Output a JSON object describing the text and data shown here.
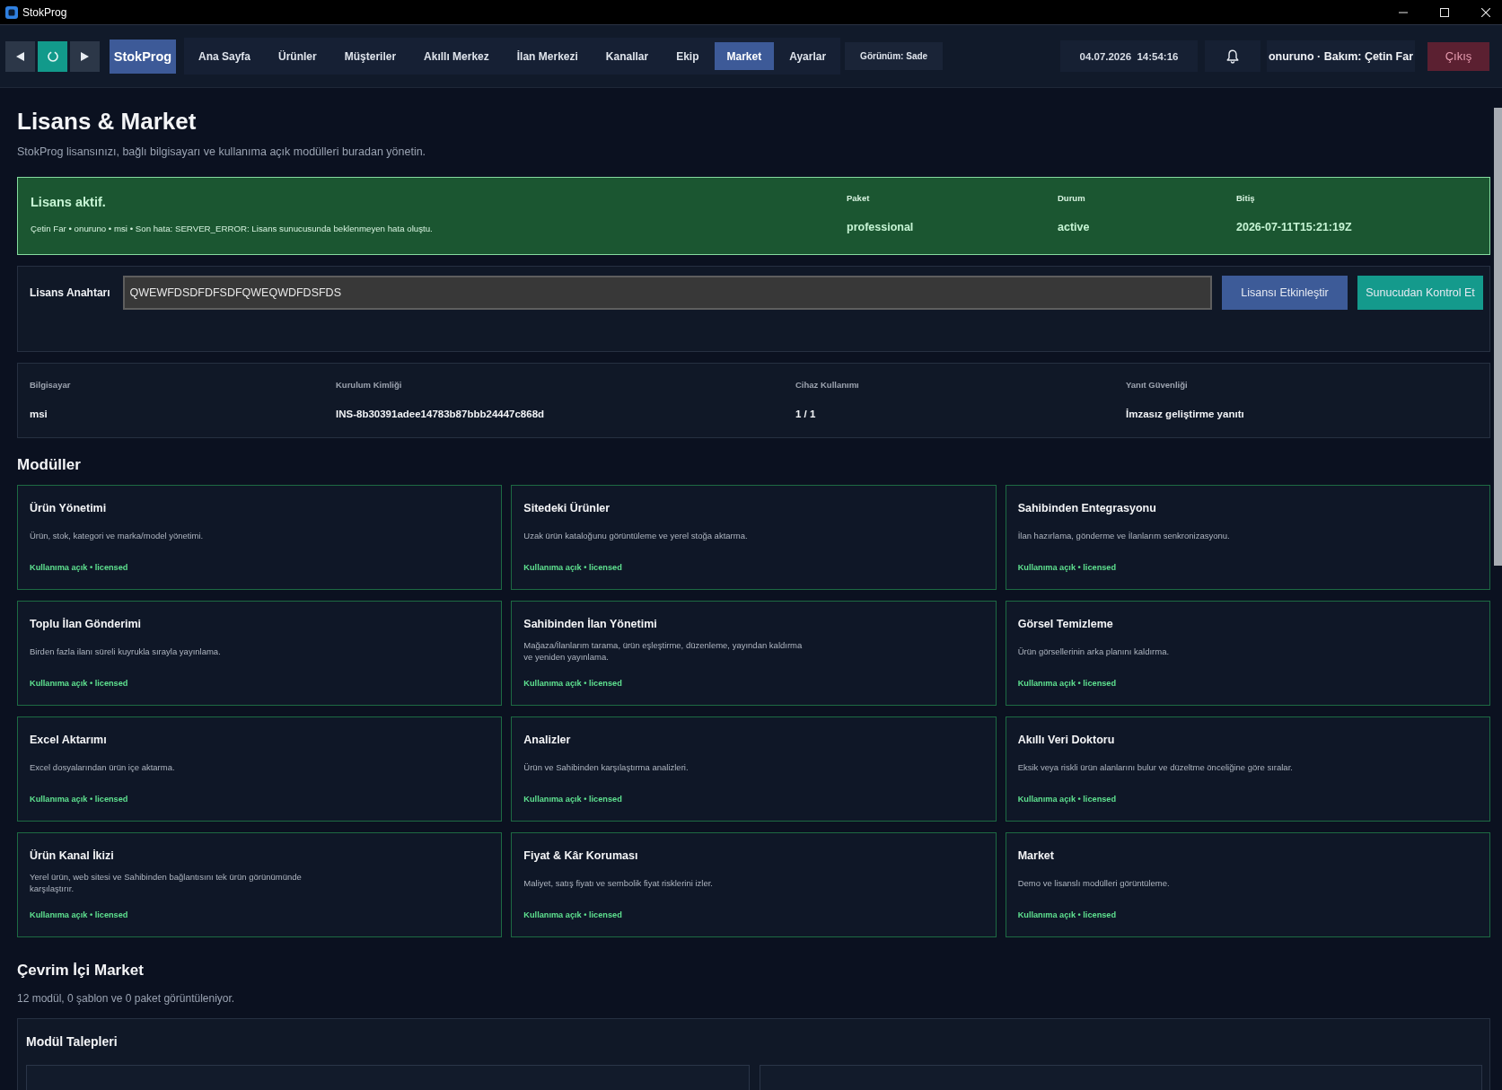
{
  "window": {
    "title": "StokProg"
  },
  "toolbar": {
    "brand": "StokProg",
    "nav": [
      {
        "label": "Ana Sayfa",
        "selected": false
      },
      {
        "label": "Ürünler",
        "selected": false
      },
      {
        "label": "Müşteriler",
        "selected": false
      },
      {
        "label": "Akıllı Merkez",
        "selected": false
      },
      {
        "label": "İlan Merkezi",
        "selected": false
      },
      {
        "label": "Kanallar",
        "selected": false
      },
      {
        "label": "Ekip",
        "selected": false
      },
      {
        "label": "Market",
        "selected": true
      },
      {
        "label": "Ayarlar",
        "selected": false
      }
    ],
    "view_mode": "Görünüm: Sade",
    "datetime": "04.07.2026  14:54:16",
    "user": "onuruno · Bakım: Çetin Far",
    "logout": "Çıkış"
  },
  "page": {
    "title": "Lisans & Market",
    "subtitle": "StokProg lisansınızı, bağlı bilgisayarı ve kullanıma açık modülleri buradan yönetin."
  },
  "license_status": {
    "title": "Lisans aktif.",
    "details": "Çetin Far • onuruno • msi • Son hata: SERVER_ERROR: Lisans sunucusunda beklenmeyen hata oluştu.",
    "fields": [
      {
        "label": "Paket",
        "value": "professional"
      },
      {
        "label": "Durum",
        "value": "active"
      },
      {
        "label": "Bitiş",
        "value": "2026-07-11T15:21:19Z"
      }
    ]
  },
  "license_key": {
    "label": "Lisans Anahtarı",
    "value": "QWEWFDSDFDFSDFQWEQWDFDSFDS",
    "buttons": [
      {
        "label": "Lisansı Etkinleştir",
        "kind": "primary"
      },
      {
        "label": "Sunucudan Kontrol Et",
        "kind": "accent"
      }
    ]
  },
  "device": {
    "fields": [
      {
        "label": "Bilgisayar",
        "value": "msi"
      },
      {
        "label": "Kurulum Kimliği",
        "value": "INS-8b30391adee14783b87bbb24447c868d"
      },
      {
        "label": "Cihaz Kullanımı",
        "value": "1 / 1"
      },
      {
        "label": "Yanıt Güvenliği",
        "value": "İmzasız geliştirme yanıtı"
      }
    ]
  },
  "modules": {
    "title": "Modüller",
    "items": [
      {
        "name": "Ürün Yönetimi",
        "description": "Ürün, stok, kategori ve marka/model yönetimi.",
        "status": "Kullanıma açık • licensed"
      },
      {
        "name": "Sitedeki Ürünler",
        "description": "Uzak ürün kataloğunu görüntüleme ve yerel stoğa aktarma.",
        "status": "Kullanıma açık • licensed"
      },
      {
        "name": "Sahibinden Entegrasyonu",
        "description": "İlan hazırlama, gönderme ve İlanlarım senkronizasyonu.",
        "status": "Kullanıma açık • licensed"
      },
      {
        "name": "Toplu İlan Gönderimi",
        "description": "Birden fazla ilanı süreli kuyrukla sırayla yayınlama.",
        "status": "Kullanıma açık • licensed"
      },
      {
        "name": "Sahibinden İlan Yönetimi",
        "description": "Mağaza/İlanlarım tarama, ürün eşleştirme, düzenleme, yayından kaldırma ve yeniden yayınlama.",
        "status": "Kullanıma açık • licensed"
      },
      {
        "name": "Görsel Temizleme",
        "description": "Ürün görsellerinin arka planını kaldırma.",
        "status": "Kullanıma açık • licensed"
      },
      {
        "name": "Excel Aktarımı",
        "description": "Excel dosyalarından ürün içe aktarma.",
        "status": "Kullanıma açık • licensed"
      },
      {
        "name": "Analizler",
        "description": "Ürün ve Sahibinden karşılaştırma analizleri.",
        "status": "Kullanıma açık • licensed"
      },
      {
        "name": "Akıllı Veri Doktoru",
        "description": "Eksik veya riskli ürün alanlarını bulur ve düzeltme önceliğine göre sıralar.",
        "status": "Kullanıma açık • licensed"
      },
      {
        "name": "Ürün Kanal İkizi",
        "description": "Yerel ürün, web sitesi ve Sahibinden bağlantısını tek ürün görünümünde karşılaştırır.",
        "status": "Kullanıma açık • licensed"
      },
      {
        "name": "Fiyat & Kâr Koruması",
        "description": "Maliyet, satış fiyatı ve sembolik fiyat risklerini izler.",
        "status": "Kullanıma açık • licensed"
      },
      {
        "name": "Market",
        "description": "Demo ve lisanslı modülleri görüntüleme.",
        "status": "Kullanıma açık • licensed"
      }
    ]
  },
  "online_market": {
    "title": "Çevrim İçi Market",
    "summary": "12 modül, 0 şablon ve 0 paket görüntüleniyor.",
    "requests_panel": {
      "title": "Modül Talepleri"
    }
  }
}
